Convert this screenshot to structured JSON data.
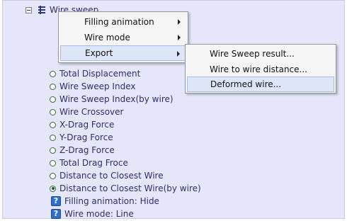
{
  "tree": {
    "root": {
      "label": "Wire sweep"
    },
    "items": [
      {
        "type": "radio",
        "label": "Total Displacement",
        "selected": false
      },
      {
        "type": "radio",
        "label": "Wire Sweep Index",
        "selected": false
      },
      {
        "type": "radio",
        "label": "Wire Sweep Index(by wire)",
        "selected": false
      },
      {
        "type": "radio",
        "label": "Wire Crossover",
        "selected": false
      },
      {
        "type": "radio",
        "label": "X-Drag Force",
        "selected": false
      },
      {
        "type": "radio",
        "label": "Y-Drag Force",
        "selected": false
      },
      {
        "type": "radio",
        "label": "Z-Drag Force",
        "selected": false
      },
      {
        "type": "radio",
        "label": "Total Drag Froce",
        "selected": false
      },
      {
        "type": "radio",
        "label": "Distance to Closest Wire",
        "selected": false
      },
      {
        "type": "radio",
        "label": "Distance to Closest Wire(by wire)",
        "selected": true
      },
      {
        "type": "info",
        "label": "Filling animation: Hide",
        "icon": "help-icon"
      },
      {
        "type": "info",
        "label": "Wire mode: Line",
        "icon": "help-icon"
      }
    ]
  },
  "context_menu": {
    "items": [
      {
        "label": "Filling animation",
        "has_submenu": true
      },
      {
        "label": "Wire mode",
        "has_submenu": true
      },
      {
        "label": "Export",
        "has_submenu": true,
        "highlighted": true
      }
    ]
  },
  "submenu": {
    "items": [
      {
        "label": "Wire Sweep result..."
      },
      {
        "label": "Wire to wire distance..."
      },
      {
        "label": "Deformed wire...",
        "highlighted": true
      }
    ]
  },
  "colors": {
    "panel_bg": "#e6e6fb",
    "tree_text": "#2b2f66",
    "menu_bg": "#f5f5f5",
    "menu_highlight": "#dde6f7",
    "help_icon": "#2e6fc7"
  }
}
